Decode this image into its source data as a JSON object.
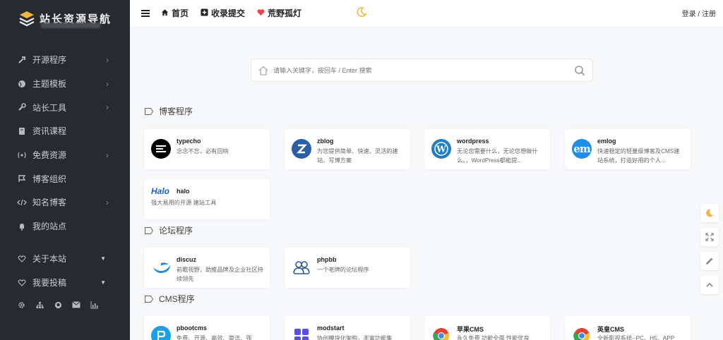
{
  "sidebar": {
    "logo_text": "站长资源导航",
    "items": [
      {
        "label": "开源程序",
        "icon": "fork-icon",
        "arrow": "›"
      },
      {
        "label": "主题模板",
        "icon": "globe-icon",
        "arrow": "›"
      },
      {
        "label": "站长工具",
        "icon": "wrench-icon",
        "arrow": "›"
      },
      {
        "label": "资讯课程",
        "icon": "book-icon",
        "arrow": ""
      },
      {
        "label": "免费资源",
        "icon": "broadcast-icon",
        "arrow": "›"
      },
      {
        "label": "博客组织",
        "icon": "flag-icon",
        "arrow": ""
      },
      {
        "label": "知名博客",
        "icon": "code-icon",
        "arrow": "›"
      },
      {
        "label": "我的站点",
        "icon": "bell-icon",
        "arrow": ""
      }
    ],
    "items2": [
      {
        "label": "关于本站",
        "icon": "heart-outline-icon",
        "arrow": "▼"
      },
      {
        "label": "我要投稿",
        "icon": "heart-outline-icon",
        "arrow": "▼"
      }
    ],
    "footer_icons": [
      "gear-icon",
      "sitemap-icon",
      "github-icon",
      "mail-icon",
      "bar-chart-icon"
    ]
  },
  "header": {
    "nav": [
      {
        "label": "首页",
        "icon": "home-icon"
      },
      {
        "label": "收录提交",
        "icon": "plus-square-icon"
      },
      {
        "label": "荒野孤灯",
        "icon": "heart-icon"
      }
    ],
    "login": "登录 / 注册"
  },
  "search": {
    "placeholder": "请输入关键字，按回车 / Enter 搜索"
  },
  "sections": [
    {
      "title": "博客程序",
      "cards": [
        {
          "name": "typecho",
          "desc": "念念不忘，必有回响"
        },
        {
          "name": "zblog",
          "desc": "为您提供简单、快速、灵活的建站、写博方案"
        },
        {
          "name": "wordpress",
          "desc": "无论您需要什么，无论您想做什么。，WordPress都能提..."
        },
        {
          "name": "emlog",
          "desc": "快速稳定的轻量级博客及CMS建站系统，打造好用的个人..."
        },
        {
          "name": "halo",
          "desc": "强大易用的开源 建站工具"
        }
      ]
    },
    {
      "title": "论坛程序",
      "cards": [
        {
          "name": "discuz",
          "desc": "前瞻视野，助推品牌及企业社区持续领先"
        },
        {
          "name": "phpbb",
          "desc": "一个老牌的论坛程序"
        }
      ]
    },
    {
      "title": "CMS程序",
      "cards": [
        {
          "name": "pbootcms",
          "desc": "免费、开源、高效、简洁、强"
        },
        {
          "name": "modstart",
          "desc": "协创模块化架构，丰富功能集"
        },
        {
          "name": "苹果CMS",
          "desc": "永久免费 功能全面 性能优良"
        },
        {
          "name": "英皇CMS",
          "desc": "全新影视系统--PC、H5、APP"
        }
      ]
    }
  ],
  "logo_texts": {
    "halo": "Halo",
    "emlog": "em"
  },
  "colors": {
    "sidebar_bg": "#272a2f",
    "accent_heart": "#e8464e",
    "moon": "#f5b440"
  }
}
